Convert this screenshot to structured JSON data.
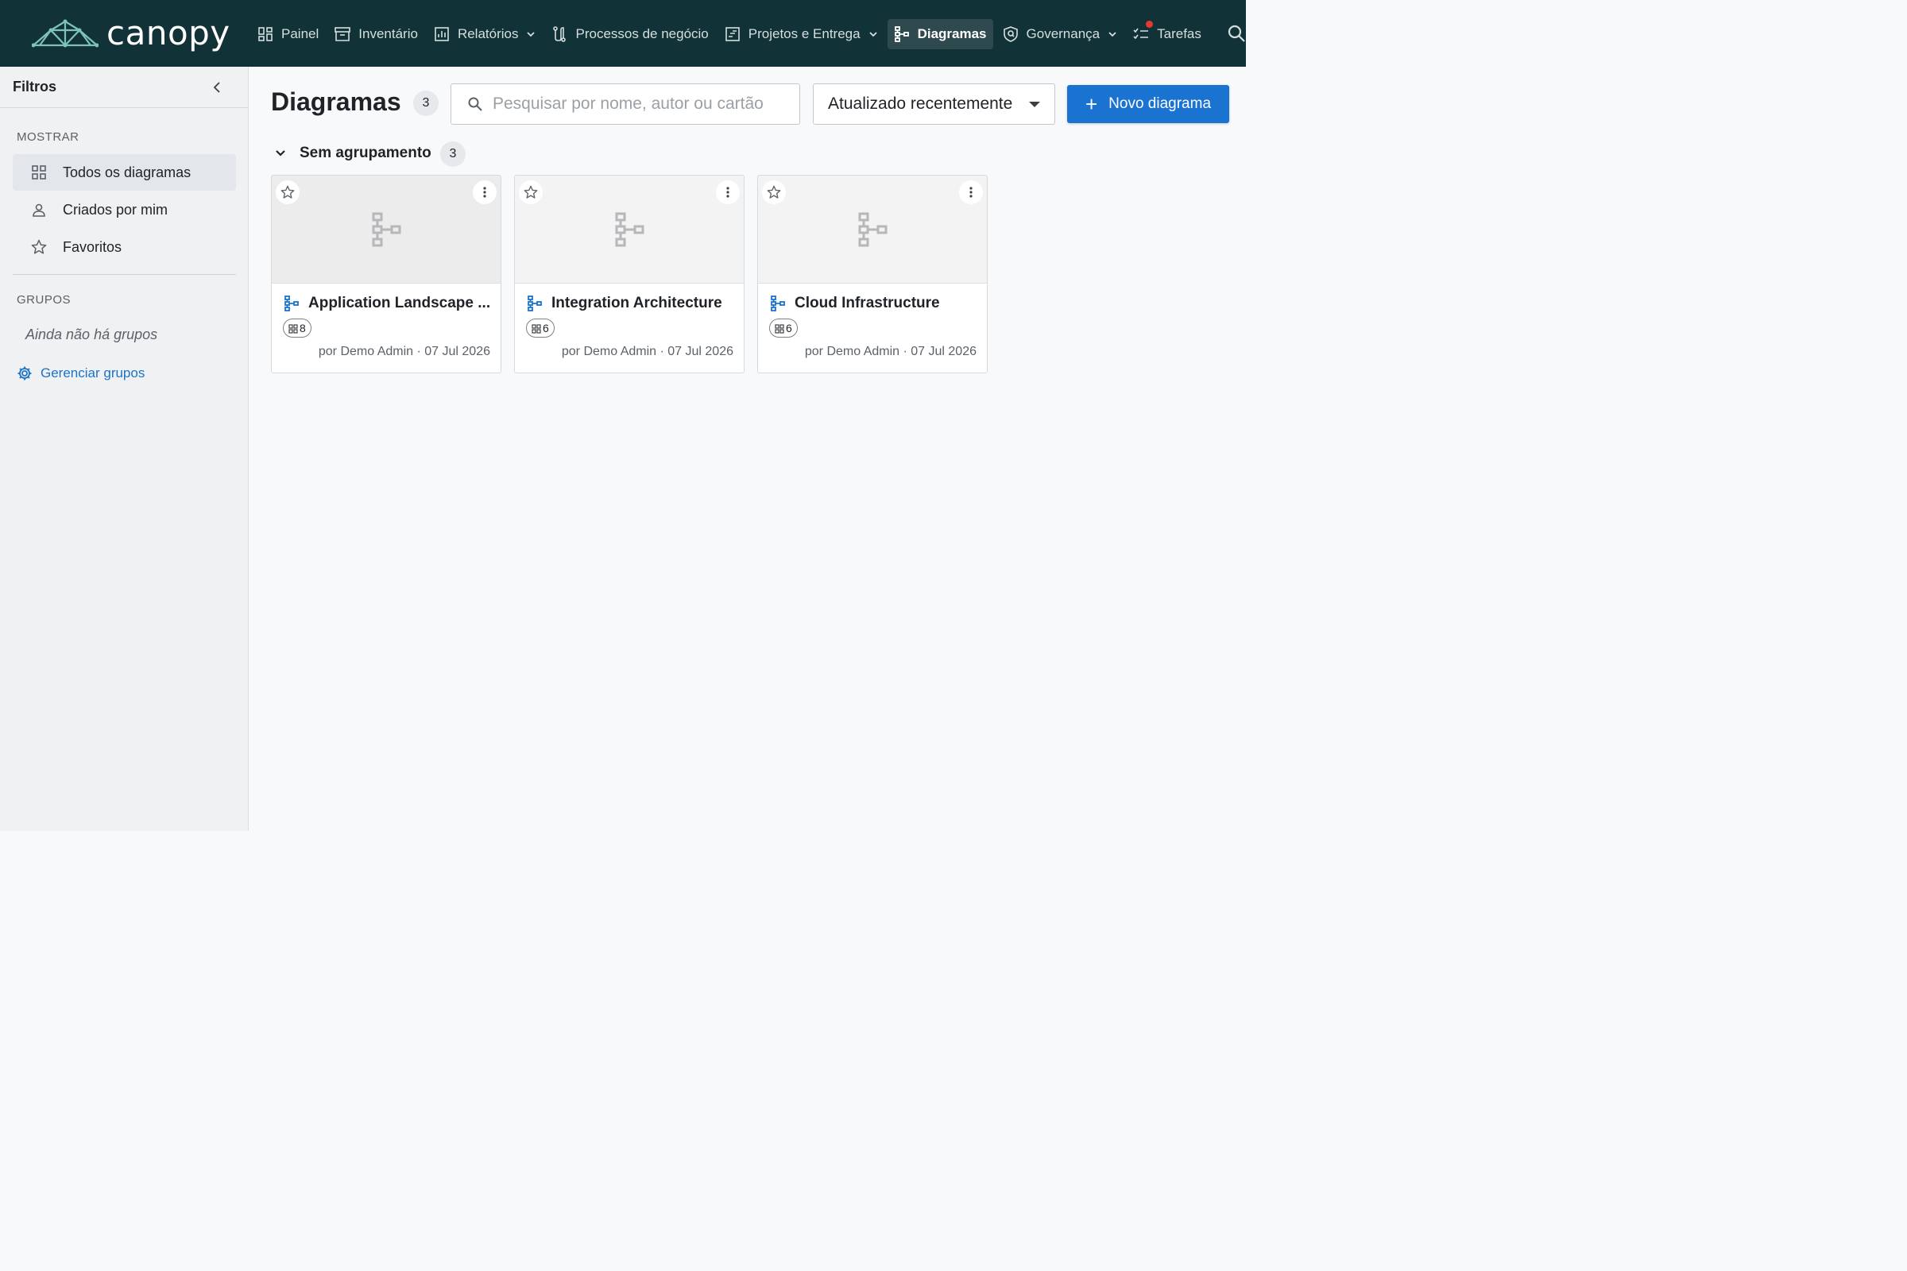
{
  "app": {
    "name": "canopy"
  },
  "nav": {
    "items": [
      {
        "label": "Painel",
        "icon": "dashboard-icon"
      },
      {
        "label": "Inventário",
        "icon": "archive-icon"
      },
      {
        "label": "Relatórios",
        "icon": "chart-icon"
      },
      {
        "label": "Processos de negócio",
        "icon": "process-icon"
      },
      {
        "label": "Projetos e Entrega",
        "icon": "project-icon"
      },
      {
        "label": "Diagramas",
        "icon": "diagram-icon"
      },
      {
        "label": "Governança",
        "icon": "shield-icon"
      },
      {
        "label": "Tarefas",
        "icon": "tasks-icon"
      }
    ],
    "active": "Diagramas"
  },
  "sidebar": {
    "title": "Filtros",
    "show_section": "MOSTRAR",
    "items": [
      {
        "label": "Todos os diagramas",
        "icon": "grid-icon"
      },
      {
        "label": "Criados por mim",
        "icon": "person-icon"
      },
      {
        "label": "Favoritos",
        "icon": "star-icon"
      }
    ],
    "groups_section": "GRUPOS",
    "groups_empty": "Ainda não há grupos",
    "manage_groups": "Gerenciar grupos"
  },
  "main": {
    "title": "Diagramas",
    "count": "3",
    "search_placeholder": "Pesquisar por nome, autor ou cartão",
    "sort_value": "Atualizado recentemente",
    "new_button": "Novo diagrama",
    "group": {
      "title": "Sem agrupamento",
      "count": "3"
    },
    "cards": [
      {
        "title": "Application Landscape ...",
        "chip": "8",
        "meta": "por Demo Admin · 07 Jul 2026"
      },
      {
        "title": "Integration Architecture",
        "chip": "6",
        "meta": "por Demo Admin · 07 Jul 2026"
      },
      {
        "title": "Cloud Infrastructure",
        "chip": "6",
        "meta": "por Demo Admin · 07 Jul 2026"
      }
    ]
  },
  "colors": {
    "topbar": "#113236",
    "accent": "#1a73d1",
    "notification": "#e53935"
  }
}
